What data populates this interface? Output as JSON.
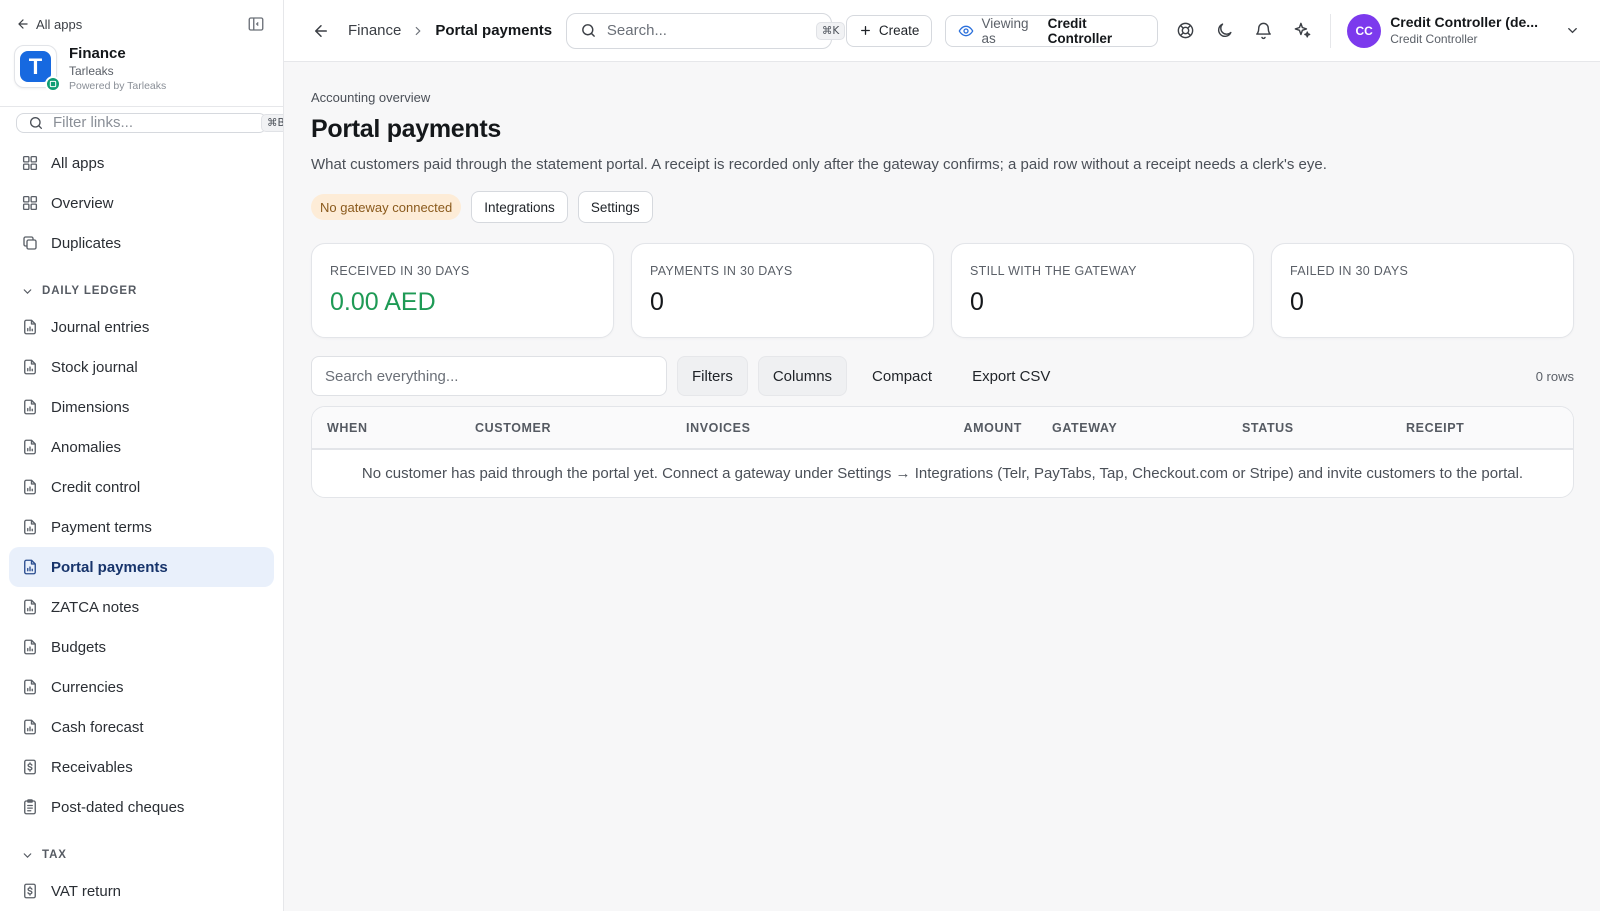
{
  "sidebar": {
    "back_label": "All apps",
    "brand": {
      "logo_letter": "T",
      "name": "Finance",
      "org": "Tarleaks",
      "powered_by": "Powered by Tarleaks"
    },
    "filter": {
      "placeholder": "Filter links...",
      "shortcut": "⌘B"
    },
    "top_items": [
      {
        "label": "All apps",
        "icon": "grid-icon"
      },
      {
        "label": "Overview",
        "icon": "grid-icon"
      },
      {
        "label": "Duplicates",
        "icon": "copy-icon"
      }
    ],
    "sections": [
      {
        "title": "DAILY LEDGER",
        "items": [
          {
            "label": "Journal entries",
            "icon": "report-icon"
          },
          {
            "label": "Stock journal",
            "icon": "report-icon"
          },
          {
            "label": "Dimensions",
            "icon": "report-icon"
          },
          {
            "label": "Anomalies",
            "icon": "report-icon"
          },
          {
            "label": "Credit control",
            "icon": "report-icon"
          },
          {
            "label": "Payment terms",
            "icon": "report-icon"
          },
          {
            "label": "Portal payments",
            "icon": "report-icon",
            "active": true
          },
          {
            "label": "ZATCA notes",
            "icon": "report-icon"
          },
          {
            "label": "Budgets",
            "icon": "report-icon"
          },
          {
            "label": "Currencies",
            "icon": "report-icon"
          },
          {
            "label": "Cash forecast",
            "icon": "report-icon"
          },
          {
            "label": "Receivables",
            "icon": "dollar-doc-icon"
          },
          {
            "label": "Post-dated cheques",
            "icon": "clipboard-icon"
          }
        ]
      },
      {
        "title": "TAX",
        "items": [
          {
            "label": "VAT return",
            "icon": "dollar-doc-icon"
          }
        ]
      }
    ]
  },
  "topbar": {
    "breadcrumb": [
      "Finance",
      "Portal payments"
    ],
    "search": {
      "placeholder": "Search...",
      "shortcut": "⌘K"
    },
    "create_label": "Create",
    "viewing_prefix": "Viewing as",
    "viewing_role": "Credit Controller",
    "user": {
      "initials": "CC",
      "name": "Credit Controller (de...",
      "role": "Credit Controller"
    }
  },
  "page": {
    "eyebrow": "Accounting overview",
    "title": "Portal payments",
    "description": "What customers paid through the statement portal. A receipt is recorded only after the gateway confirms; a paid row without a receipt needs a clerk's eye.",
    "status_badge": "No gateway connected",
    "integrations_label": "Integrations",
    "settings_label": "Settings"
  },
  "kpis": [
    {
      "label": "RECEIVED IN 30 DAYS",
      "value": "0.00 AED",
      "accent": "#1e9a55"
    },
    {
      "label": "PAYMENTS IN 30 DAYS",
      "value": "0"
    },
    {
      "label": "STILL WITH THE GATEWAY",
      "value": "0"
    },
    {
      "label": "FAILED IN 30 DAYS",
      "value": "0"
    }
  ],
  "table": {
    "search_placeholder": "Search everything...",
    "filters_label": "Filters",
    "columns_label": "Columns",
    "compact_label": "Compact",
    "export_label": "Export CSV",
    "row_count": "0 rows",
    "headers": [
      "WHEN",
      "CUSTOMER",
      "INVOICES",
      "AMOUNT",
      "GATEWAY",
      "STATUS",
      "RECEIPT"
    ],
    "empty_message": "No customer has paid through the portal yet. Connect a gateway under Settings → Integrations (Telr, PayTabs, Tap, Checkout.com or Stripe) and invite customers to the portal."
  },
  "colors": {
    "active_nav_bg": "#e9f0fb",
    "brand_blue": "#1769e0",
    "avatar_purple": "#7c3aed",
    "success_green": "#1e9a55",
    "warning_bg": "#fdecd7"
  }
}
